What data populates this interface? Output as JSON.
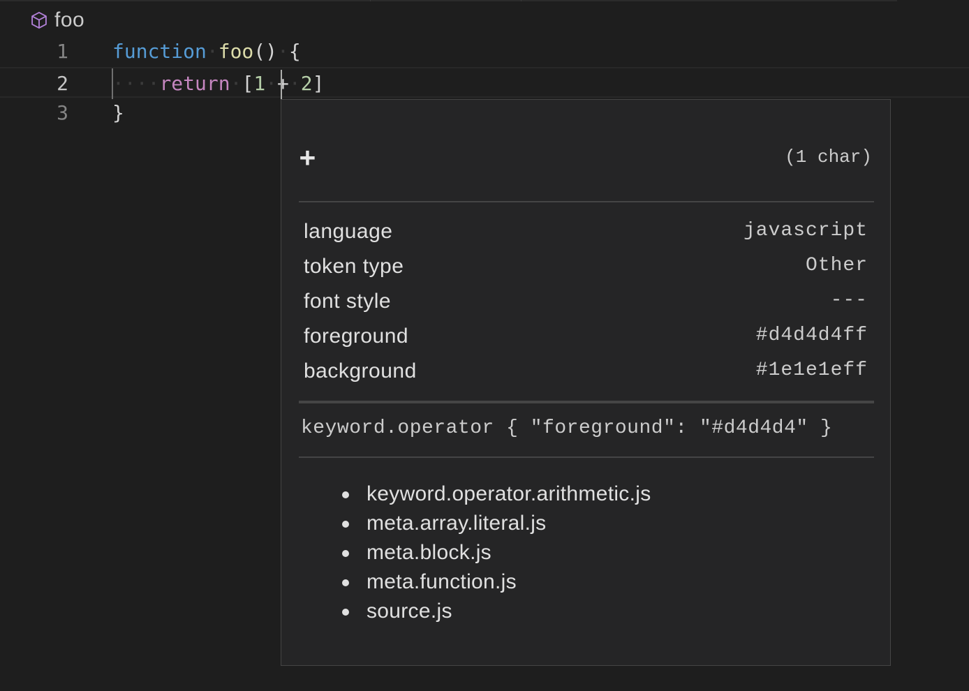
{
  "breadcrumb": {
    "icon": "cube-icon",
    "label": "foo"
  },
  "editor": {
    "line_numbers": [
      "1",
      "2",
      "3"
    ],
    "lines": [
      {
        "tokens": [
          {
            "text": "function",
            "cls": "kw-fn"
          },
          {
            "text": "·",
            "cls": "ws"
          },
          {
            "text": "foo",
            "cls": "fn"
          },
          {
            "text": "()",
            "cls": "punc"
          },
          {
            "text": "·",
            "cls": "ws"
          },
          {
            "text": "{",
            "cls": "punc"
          }
        ]
      },
      {
        "tokens": [
          {
            "text": "····",
            "cls": "ws"
          },
          {
            "text": "return",
            "cls": "kw-ret"
          },
          {
            "text": "·",
            "cls": "ws"
          },
          {
            "text": "[",
            "cls": "punc"
          },
          {
            "text": "1",
            "cls": "num"
          },
          {
            "text": "·",
            "cls": "ws"
          },
          {
            "text": "+",
            "cls": "punc"
          },
          {
            "text": "·",
            "cls": "ws"
          },
          {
            "text": "2",
            "cls": "num"
          },
          {
            "text": "]",
            "cls": "punc"
          }
        ]
      },
      {
        "tokens": [
          {
            "text": "}",
            "cls": "punc"
          }
        ]
      }
    ]
  },
  "inspector": {
    "token": "+",
    "length": "(1 char)",
    "properties": [
      {
        "key": "language",
        "value": "javascript"
      },
      {
        "key": "token type",
        "value": "Other"
      },
      {
        "key": "font style",
        "value": "---"
      },
      {
        "key": "foreground",
        "value": "#d4d4d4ff"
      },
      {
        "key": "background",
        "value": "#1e1e1eff"
      }
    ],
    "theme_rule": "keyword.operator { \"foreground\": \"#d4d4d4\" }",
    "scopes": [
      "keyword.operator.arithmetic.js",
      "meta.array.literal.js",
      "meta.block.js",
      "meta.function.js",
      "source.js"
    ]
  }
}
